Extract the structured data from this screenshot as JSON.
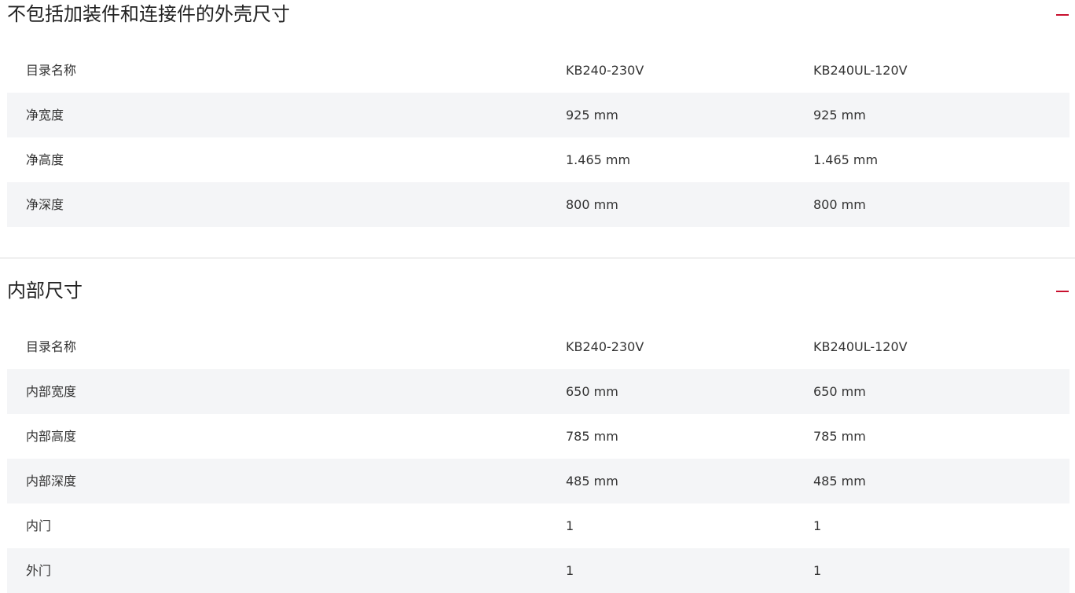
{
  "accent_color": "#c8102e",
  "icons": {
    "collapse": "minus-icon"
  },
  "outer_section": {
    "title": "不包括加装件和连接件的外壳尺寸",
    "rows": [
      {
        "label": "目录名称",
        "v1": "KB240-230V",
        "v2": "KB240UL-120V"
      },
      {
        "label": "净宽度",
        "v1": "925 mm",
        "v2": "925 mm"
      },
      {
        "label": "净高度",
        "v1": "1.465 mm",
        "v2": "1.465 mm"
      },
      {
        "label": "净深度",
        "v1": "800 mm",
        "v2": "800 mm"
      }
    ]
  },
  "inner_section": {
    "title": "内部尺寸",
    "rows": [
      {
        "label": "目录名称",
        "v1": "KB240-230V",
        "v2": "KB240UL-120V"
      },
      {
        "label": "内部宽度",
        "v1": "650 mm",
        "v2": "650 mm"
      },
      {
        "label": "内部高度",
        "v1": "785 mm",
        "v2": "785 mm"
      },
      {
        "label": "内部深度",
        "v1": "485 mm",
        "v2": "485 mm"
      },
      {
        "label": "内门",
        "v1": "1",
        "v2": "1"
      },
      {
        "label": "外门",
        "v1": "1",
        "v2": "1"
      }
    ]
  }
}
